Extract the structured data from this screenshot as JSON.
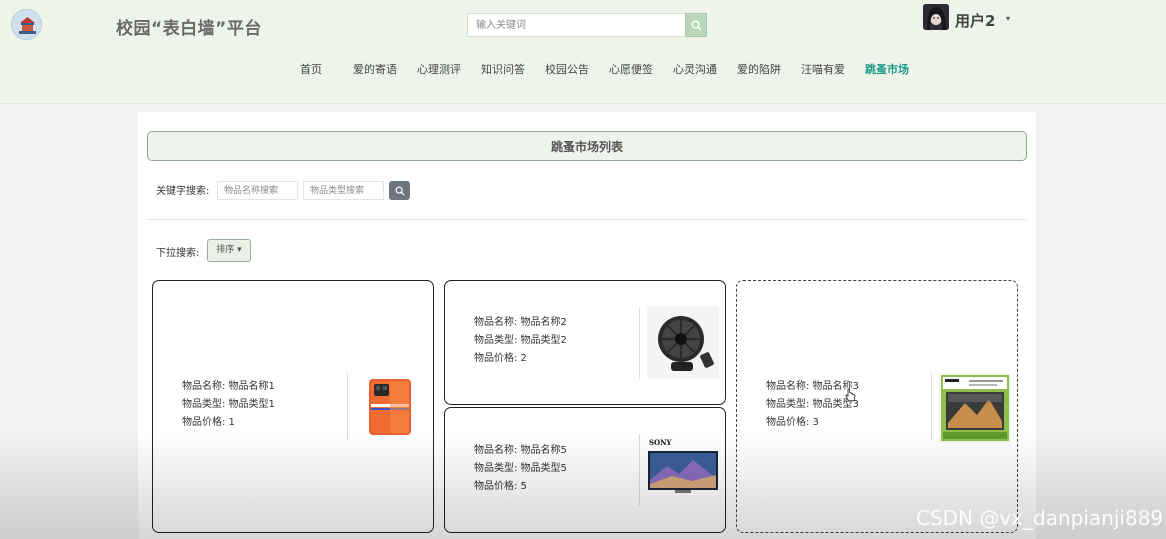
{
  "header": {
    "logo_icon": "campus-emblem-icon",
    "site_title": "校园“表白墙”平台",
    "search_placeholder": "输入关键词",
    "search_icon": "search-icon",
    "user_name": "用户2",
    "user_caret": "▾"
  },
  "nav": {
    "items": [
      {
        "label": "首页",
        "active": false
      },
      {
        "label": "爱的寄语",
        "active": false
      },
      {
        "label": "心理测评",
        "active": false
      },
      {
        "label": "知识问答",
        "active": false
      },
      {
        "label": "校园公告",
        "active": false
      },
      {
        "label": "心愿便签",
        "active": false
      },
      {
        "label": "心灵沟通",
        "active": false
      },
      {
        "label": "爱的陷阱",
        "active": false
      },
      {
        "label": "汪喵有爱",
        "active": false
      },
      {
        "label": "跳蚤市场",
        "active": true
      }
    ]
  },
  "main": {
    "list_title": "跳蚤市场列表",
    "keyword_label": "关键字搜索:",
    "name_search_placeholder": "物品名称搜索",
    "type_search_placeholder": "物品类型搜索",
    "dropdown_label": "下拉搜索:",
    "sort_label": "排序 ▾"
  },
  "items": [
    {
      "name_label": "物品名称: 物品名称1",
      "type_label": "物品类型: 物品类型1",
      "price_label": "物品价格: 1",
      "image_icon": "smartphone-image"
    },
    {
      "name_label": "物品名称: 物品名称2",
      "type_label": "物品类型: 物品类型2",
      "price_label": "物品价格: 2",
      "image_icon": "desk-fan-image"
    },
    {
      "name_label": "物品名称: 物品名称3",
      "type_label": "物品类型: 物品类型3",
      "price_label": "物品价格: 3",
      "image_icon": "tv-box-image"
    },
    {
      "name_label": "物品名称: 物品名称5",
      "type_label": "物品类型: 物品类型5",
      "price_label": "物品价格: 5",
      "image_icon": "sony-tv-image",
      "brand": "SONY"
    }
  ],
  "watermark": "CSDN @vx_danpianji889",
  "colors": {
    "header_bg": "#eef4ea",
    "accent": "#1e9a8a",
    "title_border": "#8ea58e",
    "search_btn": "#b8d7b9",
    "kw_btn": "#6e757c"
  }
}
